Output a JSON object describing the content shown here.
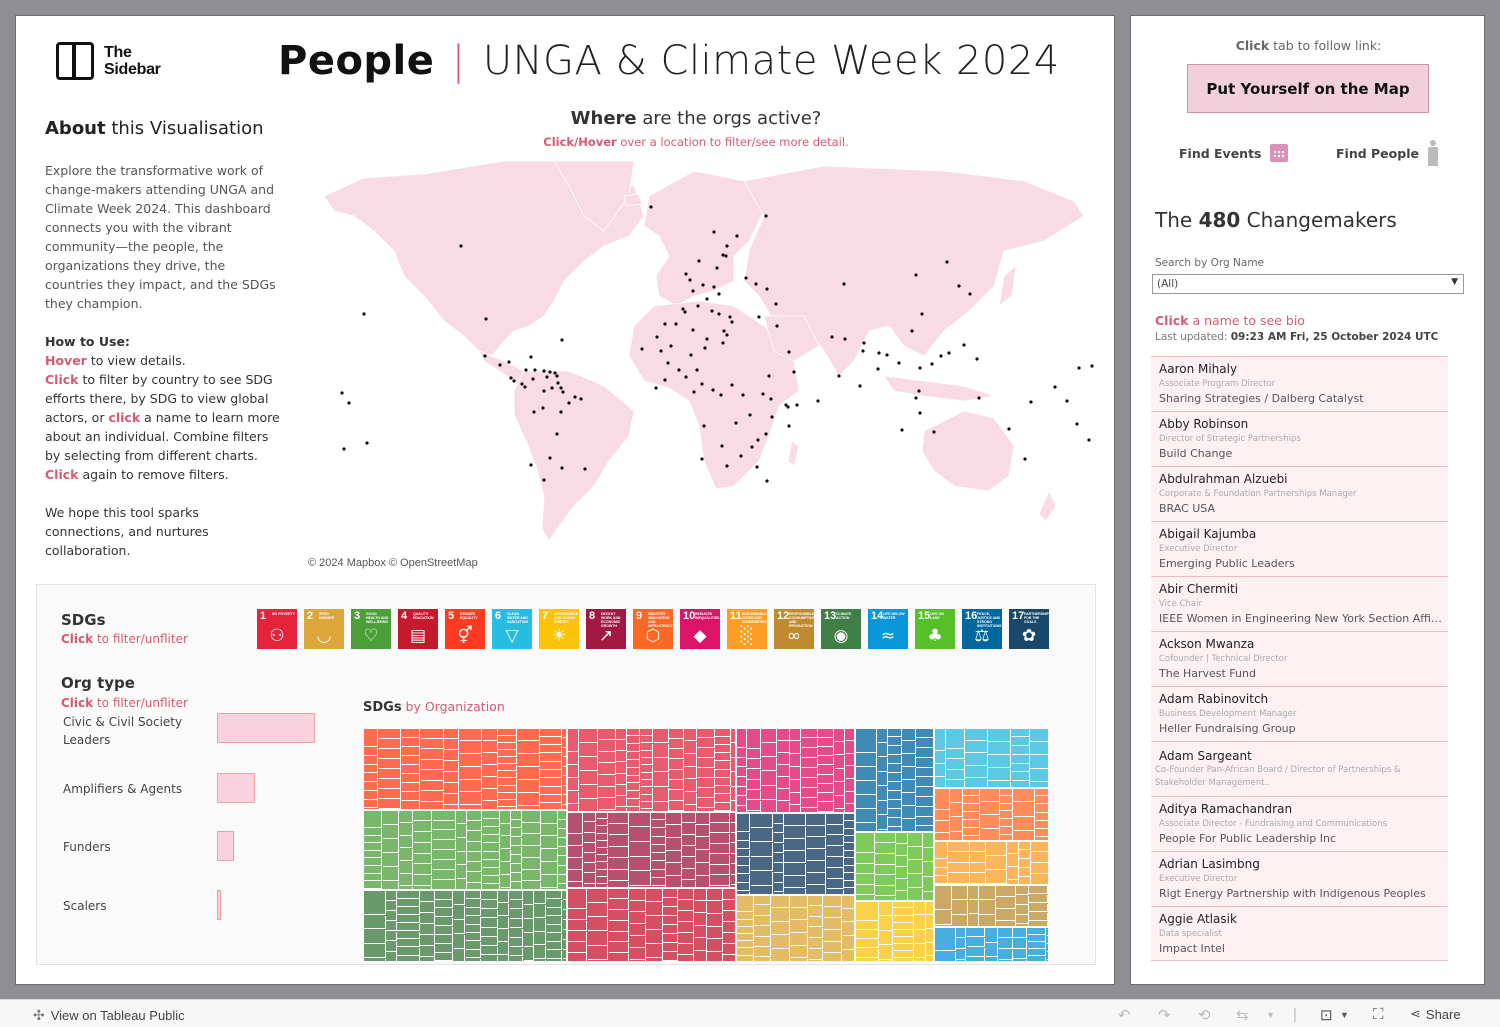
{
  "header": {
    "logo_line1": "The",
    "logo_line2": "Sidebar",
    "title_bold": "People",
    "title_sep": "|",
    "title_light": "UNGA & Climate Week 2024"
  },
  "about": {
    "title_bold": "About",
    "title_rest": " this Visualisation",
    "intro": "Explore the transformative work of change-makers attending UNGA and Climate Week 2024. This dashboard connects you with the vibrant community—the people, the organizations they drive, the countries they impact, and the SDGs they champion.",
    "howto_title": "How to Use:",
    "hover_word": "Hover",
    "hover_rest": " to view details.",
    "click_word": "Click",
    "click_rest1": " to filter by country to see SDG efforts there, by SDG to view global actors, or ",
    "click_word2": "click",
    "click_rest2": " a name to learn more about an individual. Combine filters by selecting from different charts.",
    "click_word3": "Click",
    "click_rest3": " again to remove filters.",
    "hope": "We hope this tool sparks connections, and nurtures collaboration."
  },
  "map": {
    "title_bold": "Where",
    "title_rest": " are the orgs active?",
    "sub_bold": "Click/Hover",
    "sub_rest": " over a location to filter/see more detail.",
    "credit": "© 2024 Mapbox  © OpenStreetMap",
    "land_color": "#f8dbe4",
    "dot_color": "#111111"
  },
  "sdgs": {
    "title": "SDGs",
    "sub_bold": "Click",
    "sub_rest": " to filter/unfliter",
    "items": [
      {
        "num": "1",
        "label": "No Poverty",
        "color": "#e5243b",
        "glyph": "⚇"
      },
      {
        "num": "2",
        "label": "Zero Hunger",
        "color": "#dda63a",
        "glyph": "◡"
      },
      {
        "num": "3",
        "label": "Good Health and Well-Being",
        "color": "#4c9f38",
        "glyph": "♡"
      },
      {
        "num": "4",
        "label": "Quality Education",
        "color": "#c5192d",
        "glyph": "▤"
      },
      {
        "num": "5",
        "label": "Gender Equality",
        "color": "#ff3a21",
        "glyph": "⚥"
      },
      {
        "num": "6",
        "label": "Clean Water and Sanitation",
        "color": "#26bde2",
        "glyph": "▽"
      },
      {
        "num": "7",
        "label": "Affordable and Clean Energy",
        "color": "#fcc30b",
        "glyph": "☀"
      },
      {
        "num": "8",
        "label": "Decent Work and Economic Growth",
        "color": "#a21942",
        "glyph": "↗"
      },
      {
        "num": "9",
        "label": "Industry Innovation and Infrastructure",
        "color": "#fd6925",
        "glyph": "⬡"
      },
      {
        "num": "10",
        "label": "Reduced Inequalities",
        "color": "#dd1367",
        "glyph": "◆"
      },
      {
        "num": "11",
        "label": "Sustainable Cities and Communities",
        "color": "#fd9d24",
        "glyph": "░"
      },
      {
        "num": "12",
        "label": "Responsible Consumption and Production",
        "color": "#bf8b2e",
        "glyph": "∞"
      },
      {
        "num": "13",
        "label": "Climate Action",
        "color": "#3f7e44",
        "glyph": "◉"
      },
      {
        "num": "14",
        "label": "Life Below Water",
        "color": "#0a97d9",
        "glyph": "≈"
      },
      {
        "num": "15",
        "label": "Life on Land",
        "color": "#56c02b",
        "glyph": "♣"
      },
      {
        "num": "16",
        "label": "Peace, Justice and Strong Institutions",
        "color": "#00689d",
        "glyph": "⚖"
      },
      {
        "num": "17",
        "label": "Partnerships for the Goals",
        "color": "#19486a",
        "glyph": "✿"
      }
    ]
  },
  "org_type": {
    "title": "Org type",
    "sub_bold": "Click",
    "sub_rest": " to filter/unfliter",
    "items": [
      {
        "label": "Civic & Civil Society Leaders",
        "share": 1.0
      },
      {
        "label": "Amplifiers & Agents",
        "share": 0.39
      },
      {
        "label": "Funders",
        "share": 0.17
      },
      {
        "label": "Scalers",
        "share": 0.04
      }
    ]
  },
  "treemap": {
    "title_bold": "SDGs",
    "title_rest": " by Organization",
    "groups": [
      {
        "sdg": "9",
        "color": "#ff6b50",
        "weight": 14.2
      },
      {
        "sdg": "3",
        "color": "#79b86a",
        "weight": 13.8
      },
      {
        "sdg": "13",
        "color": "#6a9a6c",
        "weight": 12.4
      },
      {
        "sdg": "1",
        "color": "#e85a6e",
        "weight": 12.0
      },
      {
        "sdg": "8",
        "color": "#b5506e",
        "weight": 11.0
      },
      {
        "sdg": "4",
        "color": "#d44f62",
        "weight": 10.6
      },
      {
        "sdg": "10",
        "color": "#e54b8b",
        "weight": 8.6
      },
      {
        "sdg": "17",
        "color": "#4a6884",
        "weight": 8.2
      },
      {
        "sdg": "2",
        "color": "#e4bc68",
        "weight": 6.8
      },
      {
        "sdg": "16",
        "color": "#3f8bb5",
        "weight": 7.0
      },
      {
        "sdg": "6",
        "color": "#5bc8e4",
        "weight": 5.8
      },
      {
        "sdg": "5",
        "color": "#ff8c5a",
        "weight": 5.2
      },
      {
        "sdg": "15",
        "color": "#7ecb5c",
        "weight": 4.6
      },
      {
        "sdg": "7",
        "color": "#fbd148",
        "weight": 4.1
      },
      {
        "sdg": "11",
        "color": "#fbb55a",
        "weight": 4.3
      },
      {
        "sdg": "12",
        "color": "#cba865",
        "weight": 4.1
      },
      {
        "sdg": "14",
        "color": "#48aee0",
        "weight": 3.4
      }
    ]
  },
  "sidebar": {
    "follow_pre": "Click",
    "follow_rest": " tab to follow link:",
    "put_button": "Put Yourself on the Map",
    "find_events": "Find Events",
    "find_people": "Find People",
    "cm_pre": "The ",
    "cm_count": "480",
    "cm_post": " Changemakers",
    "search_label": "Search by Org Name",
    "search_value": "(All)",
    "bio_bold": "Click",
    "bio_rest": " a name to see bio",
    "updated_label": "Last updated: ",
    "updated_value": "09:23 AM Fri, 25 October 2024  UTC",
    "people": [
      {
        "name": "Aaron Mihaly",
        "role": "Associate Program Director",
        "org": "Sharing Strategies / Dalberg Catalyst"
      },
      {
        "name": "Abby Robinson",
        "role": "Director of Strategic Partnerships",
        "org": "Build Change"
      },
      {
        "name": "Abdulrahman Alzuebi",
        "role": "Corporate & Foundation Partnerships Manager",
        "org": "BRAC USA"
      },
      {
        "name": "Abigail Kajumba",
        "role": "Executive Director",
        "org": "Emerging Public Leaders"
      },
      {
        "name": "Abir Chermiti",
        "role": "Vice Chair",
        "org": "IEEE Women in Engineering New York Section Affinit.."
      },
      {
        "name": "Ackson Mwanza",
        "role": "Cofounder | Technical Director",
        "org": "The Harvest Fund"
      },
      {
        "name": "Adam Rabinovitch",
        "role": "Business Development Manager",
        "org": "Heller Fundraising Group"
      },
      {
        "name": "Adam Sargeant",
        "role": "Co-Founder Pan-African Board / Director of Partnerships & Stakeholder Management..",
        "org": ""
      },
      {
        "name": "Aditya Ramachandran",
        "role": "Associate Director - Fundraising and Communications",
        "org": "People For Public Leadership Inc"
      },
      {
        "name": "Adrian Lasimbng",
        "role": "Executive Director",
        "org": "Rigt Energy Partnership with Indigenous Peoples"
      },
      {
        "name": "Aggie Atlasik",
        "role": "Data specialist",
        "org": "Impact Intel"
      }
    ]
  },
  "bottombar": {
    "view_link": "View on Tableau Public",
    "share": "Share"
  }
}
